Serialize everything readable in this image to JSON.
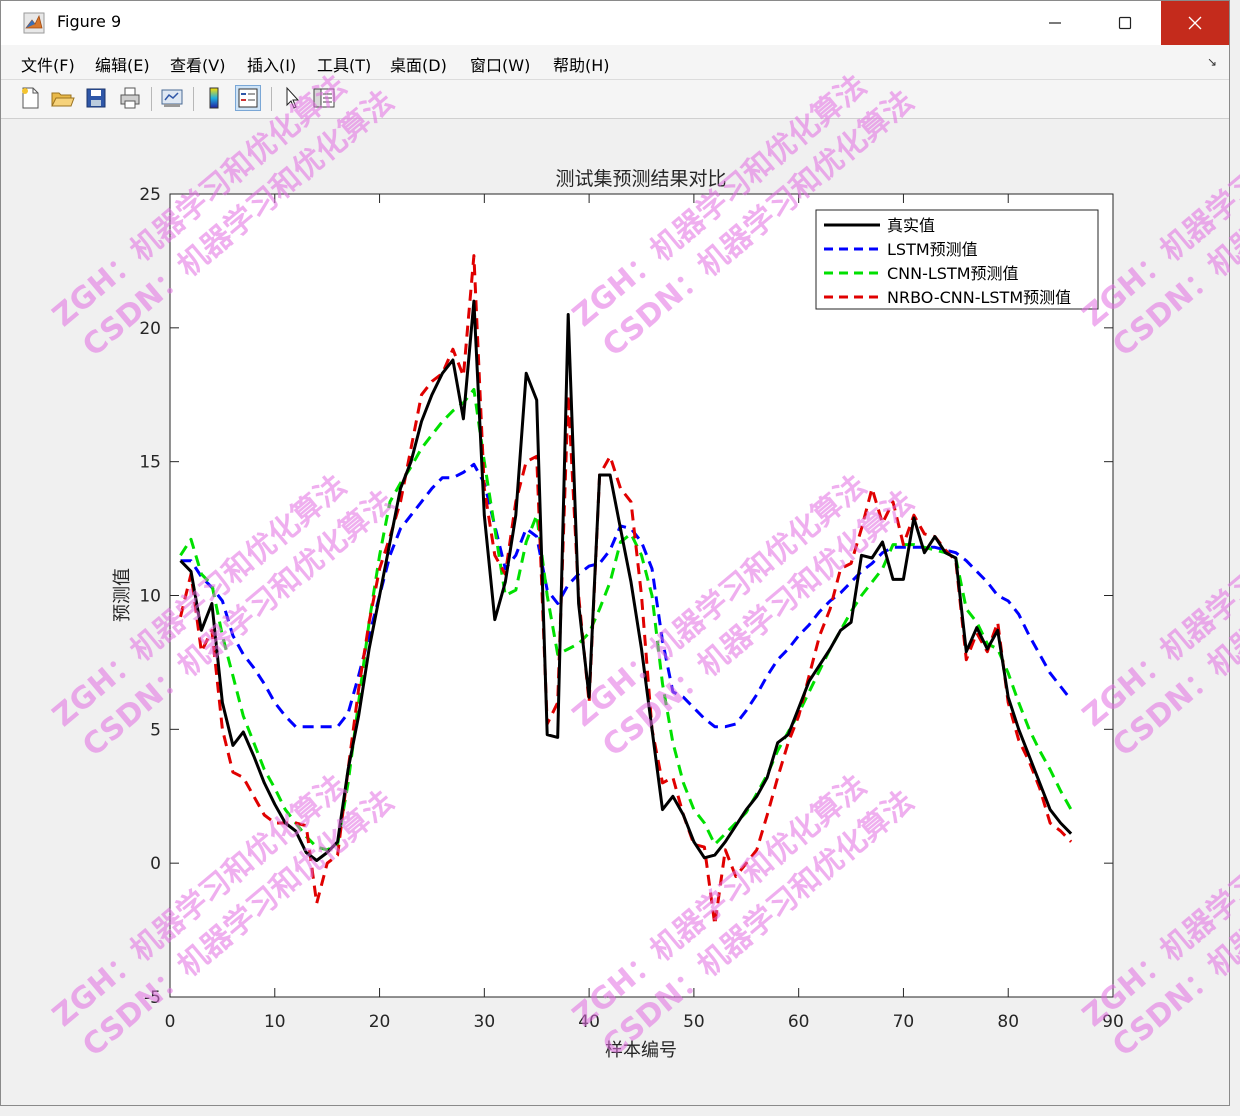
{
  "window": {
    "title": "Figure 9"
  },
  "menu": {
    "items": [
      {
        "label": "文件(F)"
      },
      {
        "label": "编辑(E)"
      },
      {
        "label": "查看(V)"
      },
      {
        "label": "插入(I)"
      },
      {
        "label": "工具(T)"
      },
      {
        "label": "桌面(D)"
      },
      {
        "label": "窗口(W)"
      },
      {
        "label": "帮助(H)"
      }
    ]
  },
  "toolbar": {
    "icons": [
      "new-figure-icon",
      "open-file-icon",
      "save-icon",
      "print-icon",
      "link-plot-icon",
      "colorbar-icon",
      "legend-icon",
      "edit-plot-icon",
      "property-inspector-icon"
    ]
  },
  "watermark": {
    "line1": "ZGH：机器学习和优化算法",
    "line2": "CSDN：机器学习和优化算法"
  },
  "chart_data": {
    "type": "line",
    "title": "测试集预测结果对比",
    "xlabel": "样本编号",
    "ylabel": "预测值",
    "xlim": [
      0,
      90
    ],
    "ylim": [
      -5,
      25
    ],
    "xticks": [
      "0",
      "10",
      "20",
      "30",
      "40",
      "50",
      "60",
      "70",
      "80",
      "90"
    ],
    "yticks": [
      "-5",
      "0",
      "5",
      "10",
      "15",
      "20",
      "25"
    ],
    "legend_position": "top-right",
    "grid": false,
    "series": [
      {
        "name": "真实值",
        "color": "#000000",
        "dash": "solid",
        "x": [
          1,
          2,
          3,
          4,
          5,
          6,
          7,
          8,
          9,
          10,
          11,
          12,
          13,
          14,
          15,
          16,
          17,
          18,
          19,
          20,
          21,
          22,
          23,
          24,
          25,
          26,
          27,
          28,
          29,
          30,
          31,
          32,
          33,
          34,
          35,
          36,
          37,
          38,
          39,
          40,
          41,
          42,
          43,
          44,
          45,
          46,
          47,
          48,
          49,
          50,
          51,
          52,
          53,
          54,
          55,
          56,
          57,
          58,
          59,
          60,
          61,
          62,
          63,
          64,
          65,
          66,
          67,
          68,
          69,
          70,
          71,
          72,
          73,
          74,
          75,
          76,
          77,
          78,
          79,
          80,
          81,
          82,
          83,
          84,
          85,
          86
        ],
        "values": [
          11.3,
          10.9,
          8.7,
          9.7,
          6.0,
          4.4,
          4.9,
          4.0,
          3.0,
          2.2,
          1.5,
          1.2,
          0.4,
          0.1,
          0.4,
          0.8,
          3.5,
          5.5,
          8.0,
          10.0,
          12.0,
          14.0,
          15.0,
          16.5,
          17.5,
          18.3,
          18.8,
          16.6,
          21.0,
          13.0,
          9.1,
          10.5,
          13.0,
          18.3,
          17.3,
          4.8,
          4.7,
          20.5,
          9.7,
          6.2,
          14.5,
          14.5,
          12.5,
          10.5,
          8.0,
          5.0,
          2.0,
          2.5,
          1.8,
          0.8,
          0.2,
          0.3,
          0.8,
          1.4,
          2.0,
          2.5,
          3.2,
          4.5,
          4.8,
          5.8,
          6.8,
          7.4,
          8.0,
          8.7,
          9.0,
          11.5,
          11.4,
          12.0,
          10.6,
          10.6,
          12.9,
          11.6,
          12.2,
          11.6,
          11.4,
          7.9,
          8.8,
          8.0,
          8.7,
          6.2,
          5.0,
          4.0,
          3.0,
          2.0,
          1.5,
          1.1
        ]
      },
      {
        "name": "LSTM预测值",
        "color": "#0000ff",
        "dash": "dash",
        "x": [
          1,
          2,
          3,
          4,
          5,
          6,
          7,
          8,
          9,
          10,
          11,
          12,
          13,
          14,
          15,
          16,
          17,
          18,
          19,
          20,
          21,
          22,
          23,
          24,
          25,
          26,
          27,
          28,
          29,
          30,
          31,
          32,
          33,
          34,
          35,
          36,
          37,
          38,
          39,
          40,
          41,
          42,
          43,
          44,
          45,
          46,
          47,
          48,
          49,
          50,
          51,
          52,
          53,
          54,
          55,
          56,
          57,
          58,
          59,
          60,
          61,
          62,
          63,
          64,
          65,
          66,
          67,
          68,
          69,
          70,
          71,
          72,
          73,
          74,
          75,
          76,
          77,
          78,
          79,
          80,
          81,
          82,
          83,
          84,
          85,
          86
        ],
        "values": [
          11.3,
          11.3,
          10.7,
          10.3,
          9.8,
          8.5,
          7.8,
          7.3,
          6.7,
          6.0,
          5.5,
          5.1,
          5.1,
          5.1,
          5.1,
          5.1,
          5.6,
          7.0,
          8.5,
          10.0,
          11.5,
          12.5,
          13.0,
          13.5,
          14.0,
          14.4,
          14.4,
          14.6,
          14.9,
          14.2,
          12.6,
          11.0,
          11.5,
          12.5,
          12.2,
          10.2,
          9.7,
          10.4,
          10.8,
          11.1,
          11.2,
          11.7,
          12.6,
          12.5,
          12.0,
          11.0,
          8.3,
          6.4,
          6.2,
          5.8,
          5.4,
          5.1,
          5.1,
          5.2,
          5.7,
          6.3,
          7.0,
          7.6,
          8.0,
          8.5,
          8.9,
          9.4,
          9.8,
          10.1,
          10.5,
          10.9,
          11.2,
          11.6,
          11.8,
          11.8,
          11.8,
          11.8,
          11.8,
          11.7,
          11.6,
          11.3,
          10.9,
          10.5,
          10.0,
          9.8,
          9.3,
          8.5,
          7.8,
          7.1,
          6.6,
          6.1
        ]
      },
      {
        "name": "CNN-LSTM预测值",
        "color": "#00e000",
        "dash": "dash",
        "x": [
          1,
          2,
          3,
          4,
          5,
          6,
          7,
          8,
          9,
          10,
          11,
          12,
          13,
          14,
          15,
          16,
          17,
          18,
          19,
          20,
          21,
          22,
          23,
          24,
          25,
          26,
          27,
          28,
          29,
          30,
          31,
          32,
          33,
          34,
          35,
          36,
          37,
          38,
          39,
          40,
          41,
          42,
          43,
          44,
          45,
          46,
          47,
          48,
          49,
          50,
          51,
          52,
          53,
          54,
          55,
          56,
          57,
          58,
          59,
          60,
          61,
          62,
          63,
          64,
          65,
          66,
          67,
          68,
          69,
          70,
          71,
          72,
          73,
          74,
          75,
          76,
          77,
          78,
          79,
          80,
          81,
          82,
          83,
          84,
          85,
          86
        ],
        "values": [
          11.5,
          12.1,
          10.8,
          10.4,
          8.5,
          7.0,
          5.5,
          4.5,
          3.5,
          2.8,
          2.0,
          1.5,
          1.0,
          0.6,
          0.5,
          0.7,
          3.0,
          6.0,
          9.0,
          11.5,
          13.5,
          14.2,
          14.8,
          15.5,
          16.0,
          16.5,
          16.9,
          17.2,
          17.7,
          15.0,
          12.5,
          10.0,
          10.2,
          12.0,
          13.0,
          10.0,
          7.8,
          8.0,
          8.2,
          8.6,
          9.5,
          10.5,
          12.0,
          12.3,
          11.5,
          10.0,
          6.7,
          4.5,
          3.0,
          2.0,
          1.5,
          0.7,
          1.1,
          1.5,
          1.9,
          2.6,
          3.3,
          4.2,
          4.9,
          5.6,
          6.4,
          7.2,
          8.0,
          8.7,
          9.4,
          10.0,
          10.5,
          11.0,
          11.9,
          11.9,
          11.9,
          11.8,
          11.7,
          11.6,
          11.4,
          9.5,
          9.0,
          8.2,
          8.0,
          7.1,
          6.0,
          5.0,
          4.2,
          3.5,
          2.7,
          2.0
        ]
      },
      {
        "name": "NRBO-CNN-LSTM预测值",
        "color": "#e00000",
        "dash": "dash",
        "x": [
          1,
          2,
          3,
          4,
          5,
          6,
          7,
          8,
          9,
          10,
          11,
          12,
          13,
          14,
          15,
          16,
          17,
          18,
          19,
          20,
          21,
          22,
          23,
          24,
          25,
          26,
          27,
          28,
          29,
          30,
          31,
          32,
          33,
          34,
          35,
          36,
          37,
          38,
          39,
          40,
          41,
          42,
          43,
          44,
          45,
          46,
          47,
          48,
          49,
          50,
          51,
          52,
          53,
          54,
          55,
          56,
          57,
          58,
          59,
          60,
          61,
          62,
          63,
          64,
          65,
          66,
          67,
          68,
          69,
          70,
          71,
          72,
          73,
          74,
          75,
          76,
          77,
          78,
          79,
          80,
          81,
          82,
          83,
          84,
          85,
          86
        ],
        "values": [
          9.2,
          10.8,
          7.9,
          8.7,
          5.0,
          3.4,
          3.2,
          2.5,
          1.8,
          1.5,
          1.5,
          1.5,
          1.4,
          -1.5,
          0.0,
          0.3,
          3.5,
          6.5,
          9.0,
          11.0,
          12.2,
          13.5,
          15.5,
          17.5,
          18.0,
          18.3,
          19.2,
          18.2,
          22.7,
          14.0,
          11.5,
          10.8,
          13.5,
          15.0,
          15.2,
          5.2,
          6.0,
          17.5,
          10.0,
          6.0,
          14.5,
          15.2,
          14.0,
          13.5,
          10.0,
          5.0,
          3.0,
          3.2,
          1.8,
          0.7,
          0.6,
          -2.3,
          0.5,
          -0.5,
          0.0,
          0.5,
          1.8,
          3.2,
          4.5,
          5.5,
          7.0,
          8.5,
          9.5,
          11.0,
          11.2,
          12.5,
          14.0,
          12.7,
          13.5,
          11.9,
          13.0,
          12.3,
          12.2,
          11.7,
          11.3,
          7.6,
          8.6,
          7.9,
          9.0,
          6.0,
          4.6,
          3.8,
          2.8,
          1.5,
          1.2,
          0.8
        ]
      }
    ]
  }
}
